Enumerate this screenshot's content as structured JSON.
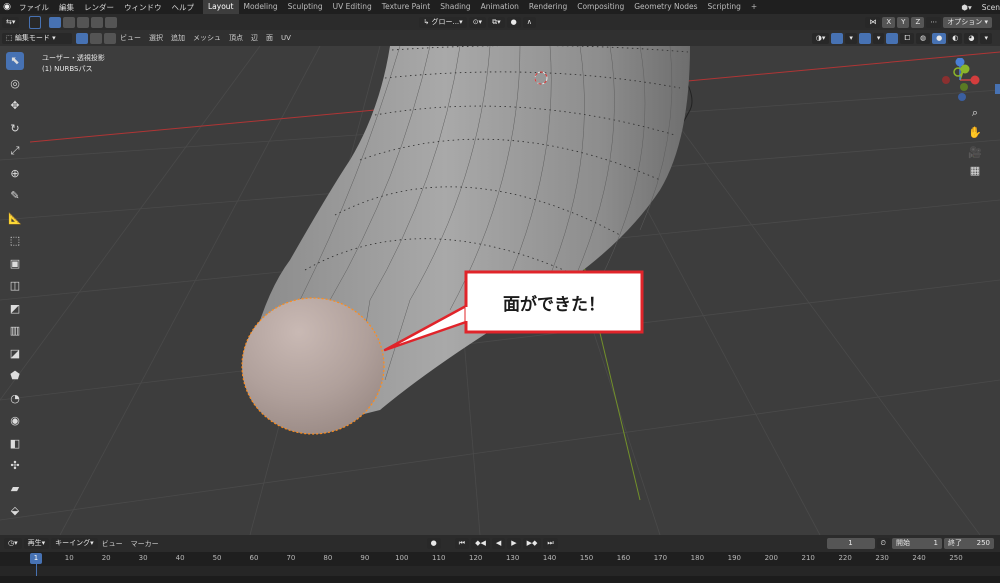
{
  "app": {
    "menu": [
      "ファイル",
      "編集",
      "レンダー",
      "ウィンドウ",
      "ヘルプ"
    ],
    "workspaces": [
      "Layout",
      "Modeling",
      "Sculpting",
      "UV Editing",
      "Texture Paint",
      "Shading",
      "Animation",
      "Rendering",
      "Compositing",
      "Geometry Nodes",
      "Scripting"
    ],
    "active_workspace": "Layout",
    "scene_label": "Scen"
  },
  "header": {
    "transform_orientation": "グロー...",
    "axes": [
      "X",
      "Y",
      "Z"
    ],
    "options_label": "オプション"
  },
  "viewport_header": {
    "mode": "編集モード",
    "menus": [
      "ビュー",
      "選択",
      "追加",
      "メッシュ",
      "頂点",
      "辺",
      "面",
      "UV"
    ]
  },
  "viewport": {
    "view_name": "ユーザー・透視投影",
    "object_name": "(1) NURBSパス",
    "callout_text": "面ができた！"
  },
  "timeline": {
    "menus": [
      "再生",
      "キーイング",
      "ビュー",
      "マーカー"
    ],
    "current_frame": "1",
    "start_label": "開始",
    "start": "1",
    "end_label": "終了",
    "end": "250",
    "ticks": [
      "1",
      "10",
      "20",
      "30",
      "40",
      "50",
      "60",
      "70",
      "80",
      "90",
      "100",
      "110",
      "120",
      "130",
      "140",
      "150",
      "160",
      "170",
      "180",
      "190",
      "200",
      "210",
      "220",
      "230",
      "240",
      "250"
    ]
  },
  "colors": {
    "accent": "#4772b3",
    "callout_border": "#e0242a",
    "selection": "#ff8c1a",
    "x_axis": "#c23a3a",
    "y_axis": "#7a9a2a"
  }
}
